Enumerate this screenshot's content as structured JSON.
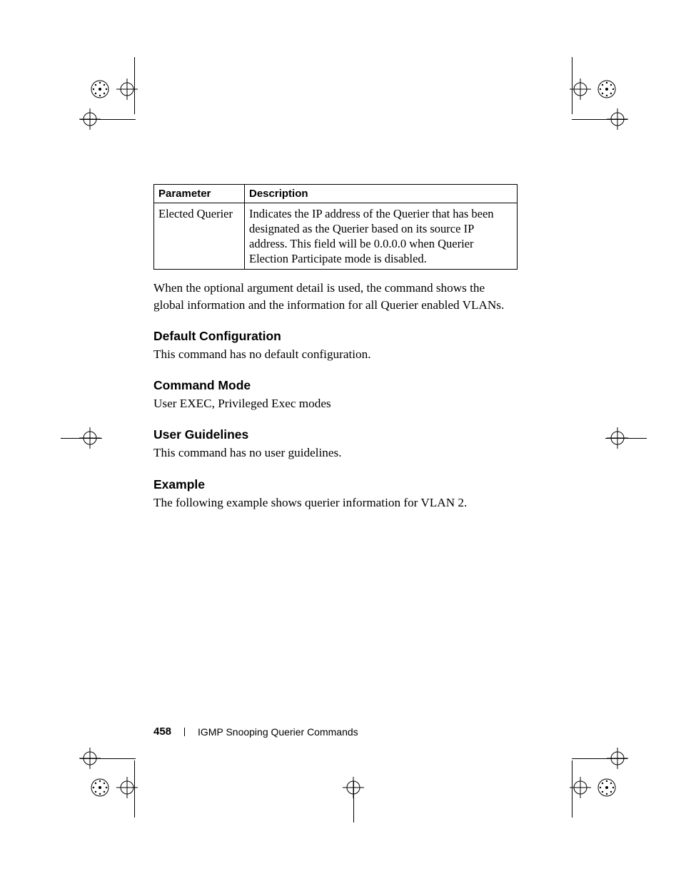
{
  "table": {
    "headers": {
      "param": "Parameter",
      "desc": "Description"
    },
    "row": {
      "param": "Elected Querier",
      "desc": "Indicates the IP address of the Querier that has been designated as the Querier based on its source IP address. This field will be 0.0.0.0 when Querier Election Participate mode is disabled."
    }
  },
  "intro": "When the optional argument detail is used, the command shows the global information and the information for all Querier enabled VLANs.",
  "sections": {
    "default_cfg": {
      "heading": "Default Configuration",
      "body": "This command has no default configuration."
    },
    "cmd_mode": {
      "heading": "Command Mode",
      "body": "User EXEC, Privileged Exec modes"
    },
    "guidelines": {
      "heading": "User Guidelines",
      "body": "This command has no user guidelines."
    },
    "example": {
      "heading": "Example",
      "body": "The following example shows querier information for VLAN 2."
    }
  },
  "footer": {
    "page": "458",
    "title": "IGMP Snooping Querier Commands"
  }
}
